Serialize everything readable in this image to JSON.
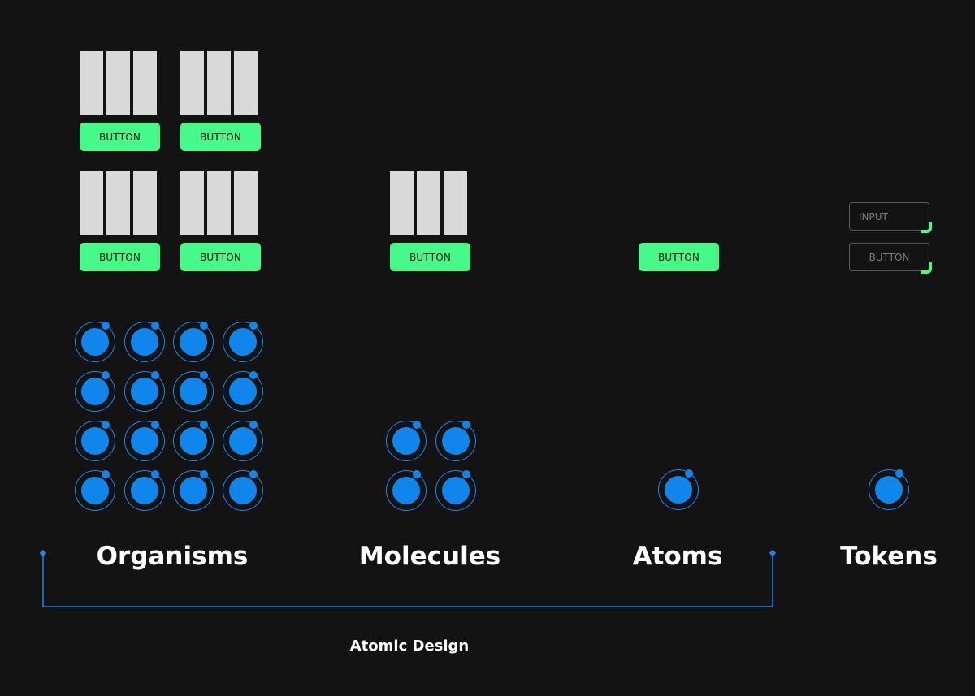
{
  "colors": {
    "background": "#131314",
    "bar": "#d9d9d9",
    "button": "#45fa89",
    "atom": "#0f86ec",
    "bracket": "#1a86ea"
  },
  "button_label": "BUTTON",
  "tokens": {
    "input_label": "INPUT",
    "button_label": "BUTTON"
  },
  "columns": {
    "organisms": "Organisms",
    "molecules": "Molecules",
    "atoms": "Atoms",
    "tokens": "Tokens"
  },
  "bracket_caption": "Atomic Design"
}
